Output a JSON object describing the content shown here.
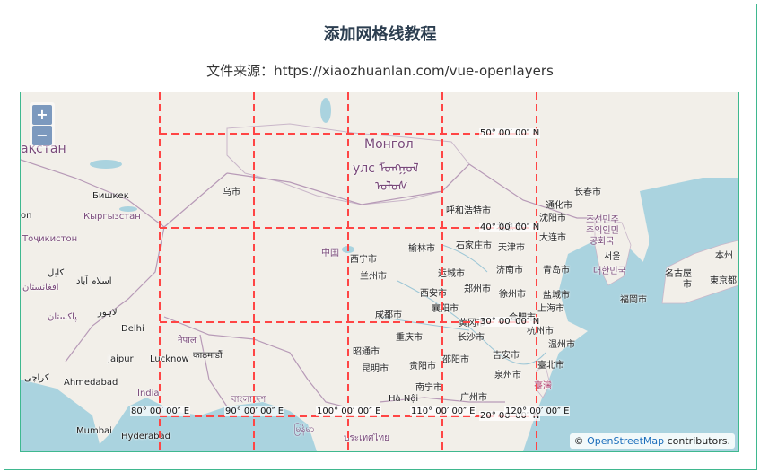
{
  "title": "添加网格线教程",
  "subtitle": "文件来源：https://xiaozhuanlan.com/vue-openlayers",
  "zoom": {
    "in_label": "+",
    "out_label": "−"
  },
  "attribution": {
    "prefix": "©",
    "link": "OpenStreetMap",
    "suffix": "contributors."
  },
  "graticule": {
    "line_color": "#ff4545",
    "lat_labels": [
      "50° 00′ 00″ N",
      "40° 00′ 00″ N",
      "30° 00′ 00″ N",
      "20° 00′ 00″ N"
    ],
    "lon_labels": [
      "80° 00′ 00″ E",
      "90° 00′ 00″ E",
      "100° 00′ 00″ E",
      "110° 00′ 00″ E",
      "120° 00′ 00″ E"
    ]
  },
  "places": {
    "kazakhstan": "ақстан",
    "mongolia_1": "Монгол",
    "mongolia_2": "улс ᠮᠤᠩᠭᠤᠯ",
    "mongolia_3": "ᠤᠯᠤᠰ",
    "bishkek": "Бишкек",
    "kyrgyzstan": "Кыргызстан",
    "tajikistan": "Тоҷикистон",
    "kabul": "کابل",
    "islamabad": "اسلام آباد",
    "afghanistan": "افغانستان",
    "pakistan": "پاکستان",
    "lahore": "لاہور",
    "delhi": "Delhi",
    "nepal": "नेपाल",
    "kathmandu": "काठमाडौं",
    "lucknow": "Lucknow",
    "jaipur": "Jaipur",
    "ahmedabad": "Ahmedabad",
    "india": "India",
    "karachi": "کراچی",
    "mumbai": "Mumbai",
    "hyderabad": "Hyderabad",
    "bangladesh": "বাংলাদেশ",
    "myanmar": "မြန်မာ",
    "thailand": "ประเทศไทย",
    "hanoi": "Hà Nội",
    "on": "on",
    "urumqi": "乌市",
    "china": "中国",
    "hohhot": "呼和浩特市",
    "xining": "西宁市",
    "lanzhou": "兰州市",
    "yulin": "榆林市",
    "shijiazhuang": "石家庄市",
    "tianjin": "天津市",
    "yuncheng": "运城市",
    "jinan": "济南市",
    "qingdao": "青岛市",
    "xian": "西安市",
    "zhengzhou": "郑州市",
    "xuzhou": "徐州市",
    "yancheng": "盐城市",
    "chengdu": "成都市",
    "xiangyang": "襄阳市",
    "shanghai": "上海市",
    "huangshi": "黄冈市",
    "hefei": "合肥市",
    "hangzhou": "杭州市",
    "chongqing": "重庆市",
    "changsha": "长沙市",
    "wenzhou": "温州市",
    "zhaotong": "昭通市",
    "guiyang": "贵阳市",
    "shaoyang": "邵阳市",
    "jian": "吉安市",
    "taipei": "臺北市",
    "kunming": "昆明市",
    "quanzhou": "泉州市",
    "taiwan": "臺灣",
    "nanning": "南宁市",
    "guangzhou": "广州市",
    "changchun": "长春市",
    "tonghua": "通化市",
    "shenyang": "沈阳市",
    "beijing": "北京市",
    "dalian": "大连市",
    "dprk_1": "조선민주",
    "dprk_2": "주의인민",
    "dprk_3": "공화국",
    "seoul": "서울",
    "korea": "대한민국",
    "nagoya": "名古屋",
    "nagoya_2": "市",
    "japan": "本州",
    "tokyo": "東京都",
    "fukuoka": "福岡市"
  }
}
